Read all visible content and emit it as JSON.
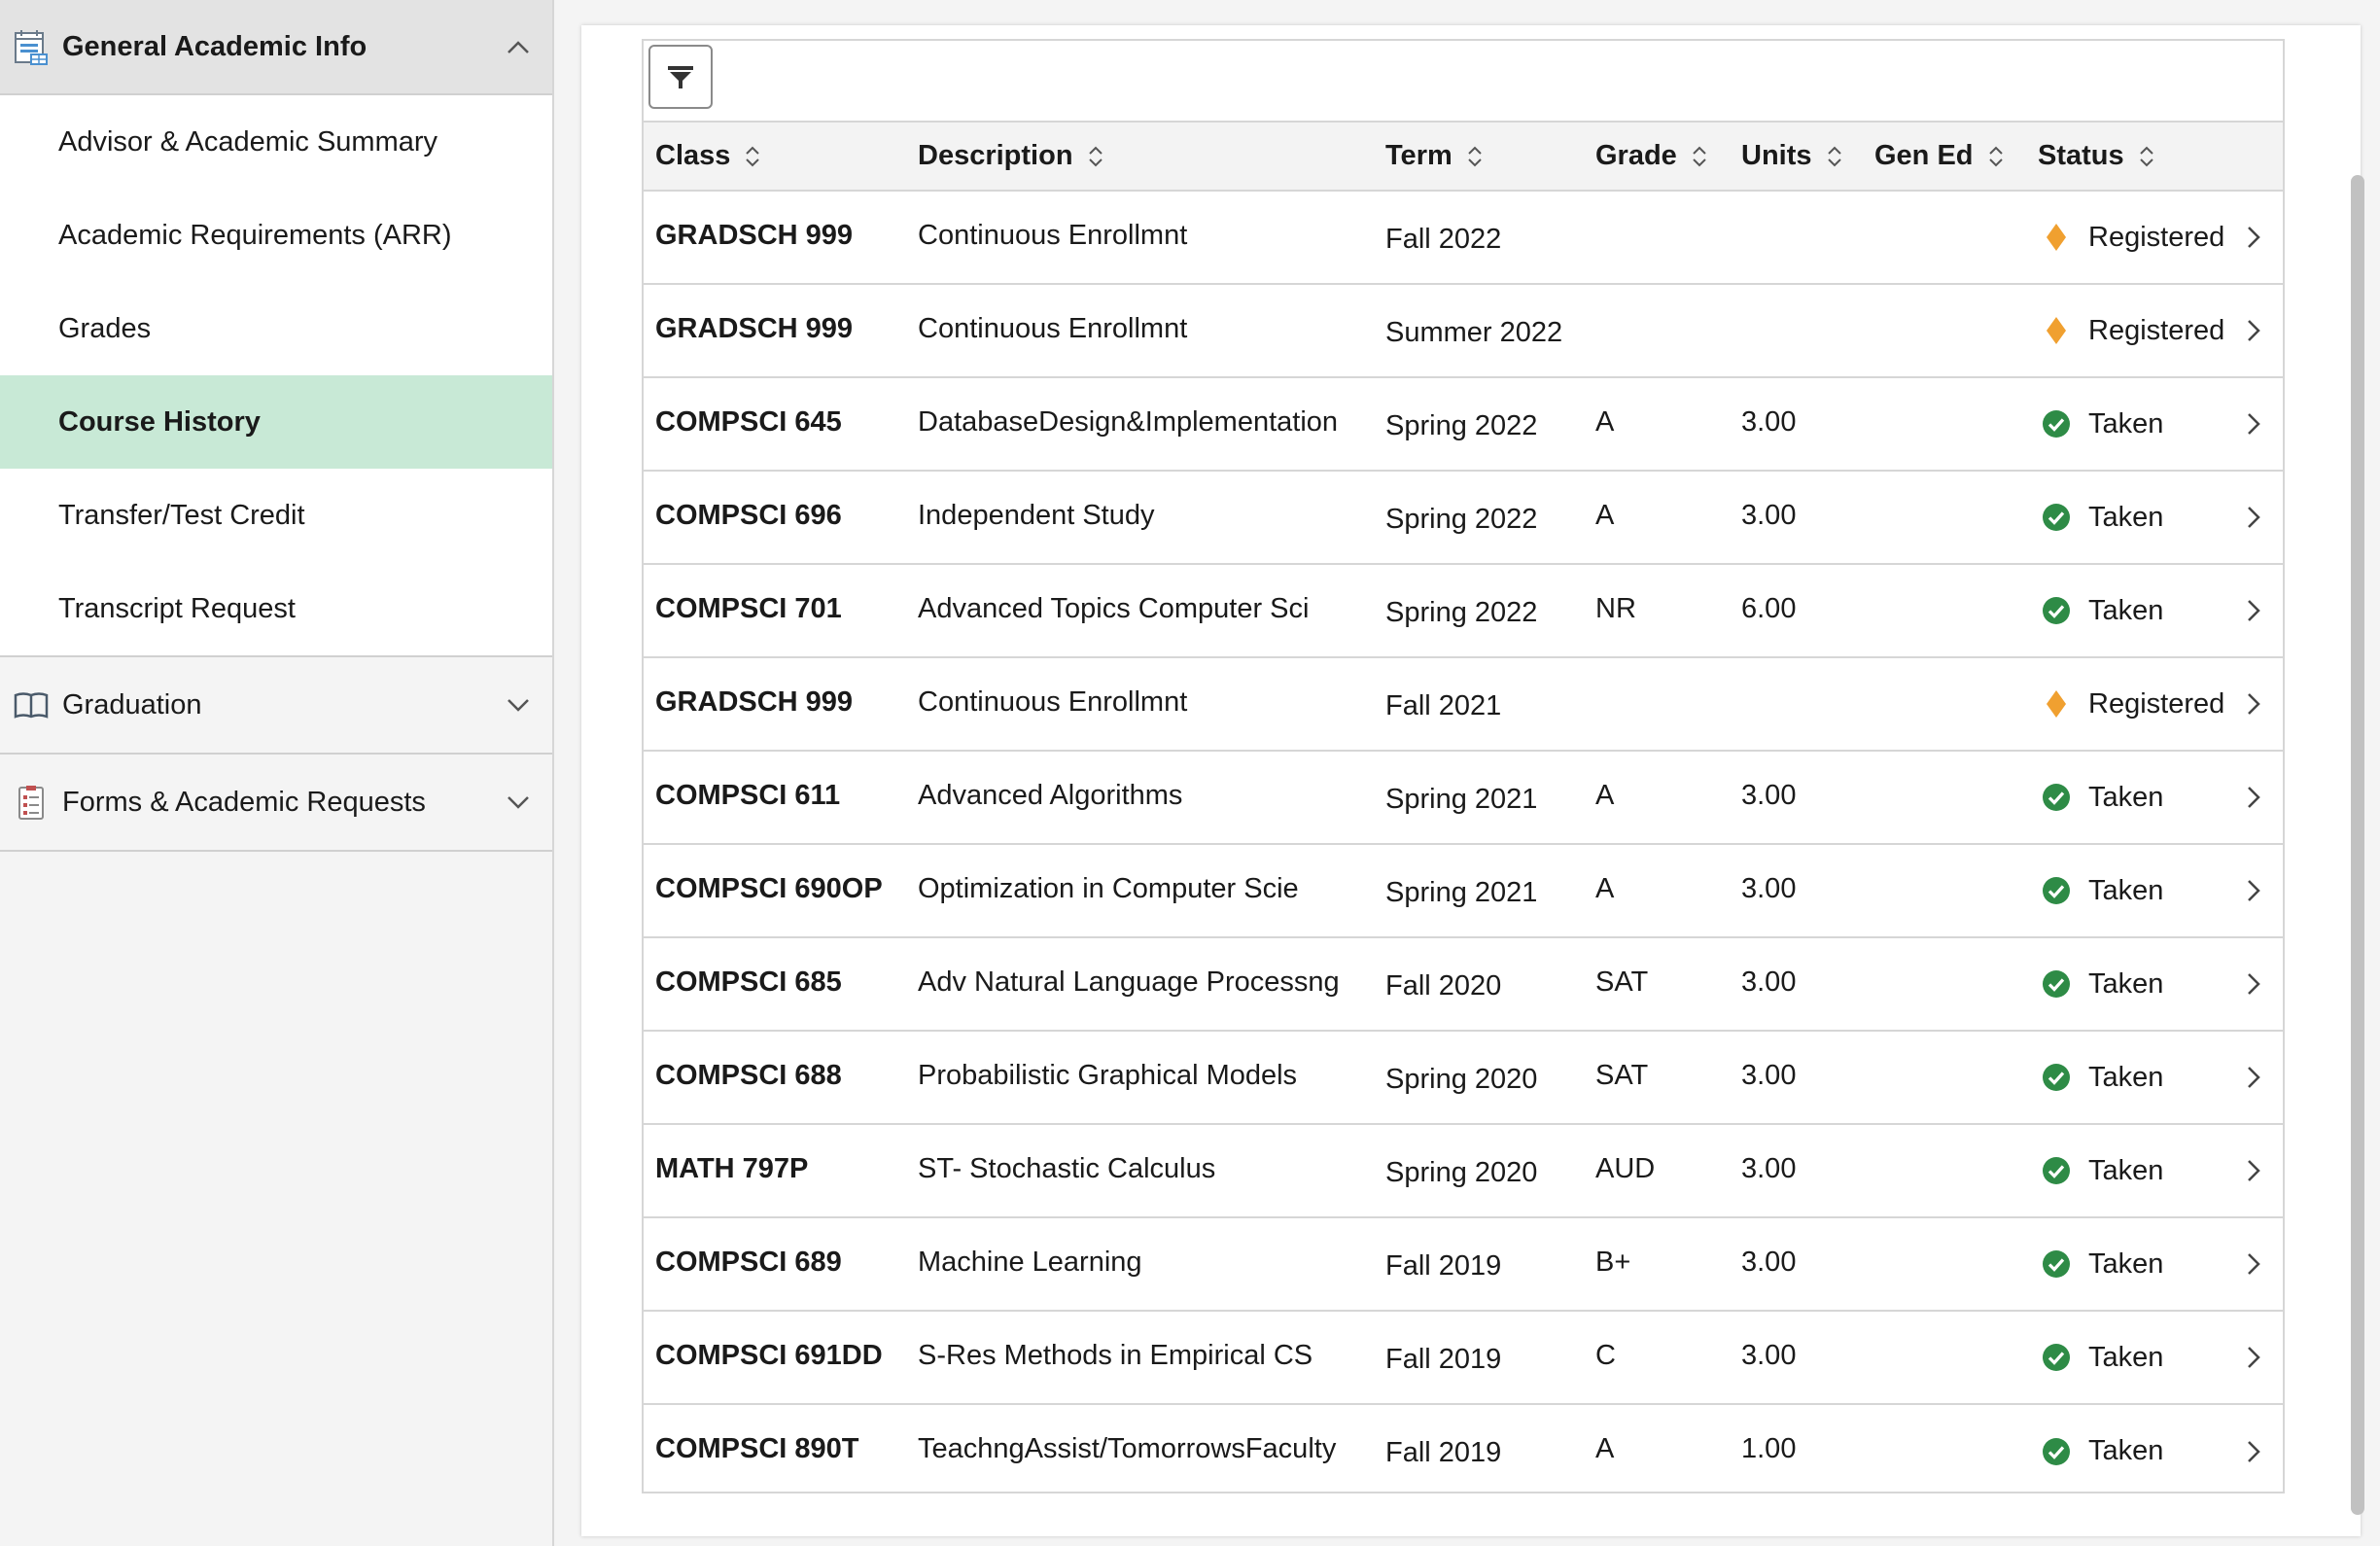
{
  "sidebar": {
    "section_general": {
      "label": "General Academic Info",
      "icon": "calendar-list-icon"
    },
    "items": [
      {
        "label": "Advisor & Academic Summary",
        "active": false
      },
      {
        "label": "Academic Requirements (ARR)",
        "active": false
      },
      {
        "label": "Grades",
        "active": false
      },
      {
        "label": "Course History",
        "active": true
      },
      {
        "label": "Transfer/Test Credit",
        "active": false
      },
      {
        "label": "Transcript Request",
        "active": false
      }
    ],
    "section_graduation": {
      "label": "Graduation",
      "icon": "open-book-icon"
    },
    "section_forms": {
      "label": "Forms & Academic Requests",
      "icon": "form-document-icon"
    }
  },
  "table": {
    "filter_icon": "filter-icon",
    "headers": {
      "class": "Class",
      "description": "Description",
      "term": "Term",
      "grade": "Grade",
      "units": "Units",
      "gen_ed": "Gen Ed",
      "status": "Status"
    },
    "rows": [
      {
        "class": "GRADSCH 999",
        "description": "Continuous Enrollmnt",
        "term": "Fall 2022",
        "grade": "",
        "units": "",
        "gen_ed": "",
        "status": "Registered",
        "status_type": "registered"
      },
      {
        "class": "GRADSCH 999",
        "description": "Continuous Enrollmnt",
        "term": "Summer 2022",
        "grade": "",
        "units": "",
        "gen_ed": "",
        "status": "Registered",
        "status_type": "registered"
      },
      {
        "class": "COMPSCI 645",
        "description": "DatabaseDesign&Implementation",
        "term": "Spring 2022",
        "grade": "A",
        "units": "3.00",
        "gen_ed": "",
        "status": "Taken",
        "status_type": "taken"
      },
      {
        "class": "COMPSCI 696",
        "description": "Independent Study",
        "term": "Spring 2022",
        "grade": "A",
        "units": "3.00",
        "gen_ed": "",
        "status": "Taken",
        "status_type": "taken"
      },
      {
        "class": "COMPSCI 701",
        "description": "Advanced Topics Computer Sci",
        "term": "Spring 2022",
        "grade": "NR",
        "units": "6.00",
        "gen_ed": "",
        "status": "Taken",
        "status_type": "taken"
      },
      {
        "class": "GRADSCH 999",
        "description": "Continuous Enrollmnt",
        "term": "Fall 2021",
        "grade": "",
        "units": "",
        "gen_ed": "",
        "status": "Registered",
        "status_type": "registered"
      },
      {
        "class": "COMPSCI 611",
        "description": "Advanced Algorithms",
        "term": "Spring 2021",
        "grade": "A",
        "units": "3.00",
        "gen_ed": "",
        "status": "Taken",
        "status_type": "taken"
      },
      {
        "class": "COMPSCI 690OP",
        "description": "Optimization in Computer Scie",
        "term": "Spring 2021",
        "grade": "A",
        "units": "3.00",
        "gen_ed": "",
        "status": "Taken",
        "status_type": "taken"
      },
      {
        "class": "COMPSCI 685",
        "description": "Adv Natural Language Processng",
        "term": "Fall 2020",
        "grade": "SAT",
        "units": "3.00",
        "gen_ed": "",
        "status": "Taken",
        "status_type": "taken"
      },
      {
        "class": "COMPSCI 688",
        "description": "Probabilistic Graphical Models",
        "term": "Spring 2020",
        "grade": "SAT",
        "units": "3.00",
        "gen_ed": "",
        "status": "Taken",
        "status_type": "taken"
      },
      {
        "class": "MATH 797P",
        "description": "ST- Stochastic Calculus",
        "term": "Spring 2020",
        "grade": "AUD",
        "units": "3.00",
        "gen_ed": "",
        "status": "Taken",
        "status_type": "taken"
      },
      {
        "class": "COMPSCI 689",
        "description": "Machine Learning",
        "term": "Fall 2019",
        "grade": "B+",
        "units": "3.00",
        "gen_ed": "",
        "status": "Taken",
        "status_type": "taken"
      },
      {
        "class": "COMPSCI 691DD",
        "description": "S-Res Methods in Empirical CS",
        "term": "Fall 2019",
        "grade": "C",
        "units": "3.00",
        "gen_ed": "",
        "status": "Taken",
        "status_type": "taken"
      },
      {
        "class": "COMPSCI 890T",
        "description": "TeachngAssist/TomorrowsFaculty",
        "term": "Fall 2019",
        "grade": "A",
        "units": "1.00",
        "gen_ed": "",
        "status": "Taken",
        "status_type": "taken"
      }
    ]
  },
  "colors": {
    "active_item_bg": "#c8e9d6",
    "registered_icon": "#f0a030",
    "taken_icon": "#2e8b46"
  }
}
